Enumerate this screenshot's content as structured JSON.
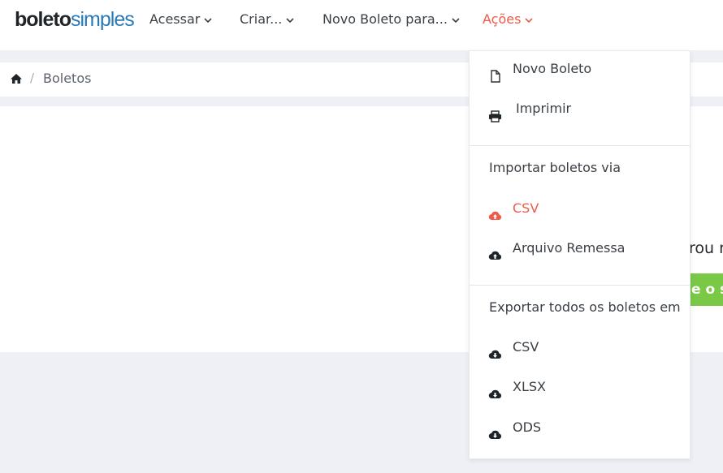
{
  "brand": {
    "part1": "boleto",
    "part2": "simples"
  },
  "nav": {
    "items": [
      {
        "label": "Acessar"
      },
      {
        "label": "Criar..."
      },
      {
        "label": "Novo Boleto para..."
      },
      {
        "label": "Ações"
      }
    ]
  },
  "breadcrumb": {
    "separator": "/",
    "current": "Boletos"
  },
  "content": {
    "partial_text": "rou n",
    "partial_button": "e o s"
  },
  "actions_menu": {
    "novo_boleto": "Novo Boleto",
    "imprimir": "Imprimir",
    "import_header": "Importar boletos via",
    "import_csv": "CSV",
    "import_remessa": "Arquivo Remessa",
    "export_header": "Exportar todos os boletos em",
    "export_csv": "CSV",
    "export_xlsx": "XLSX",
    "export_ods": "ODS"
  },
  "colors": {
    "accent": "#f05a4a",
    "brand_blue": "#2a7ab8",
    "green": "#79c947",
    "background": "#eff0f5"
  }
}
